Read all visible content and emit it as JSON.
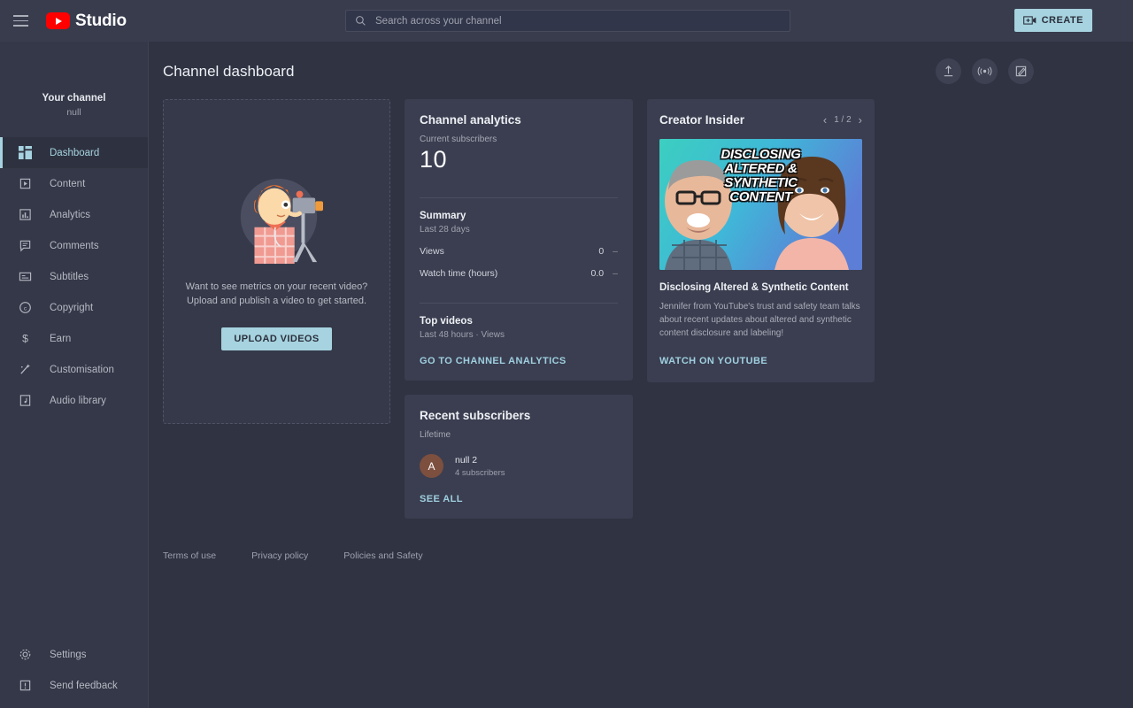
{
  "header": {
    "menu_icon": "hamburger-icon",
    "logo_text": "Studio",
    "search_placeholder": "Search across your channel",
    "search_value": "",
    "search_icon": "search-icon",
    "help_icon": "help-circle-icon",
    "create_label": "CREATE",
    "create_icon": "create-video-icon"
  },
  "sidebar": {
    "channel_label": "Your channel",
    "channel_name": "null",
    "items": [
      {
        "label": "Dashboard",
        "icon": "dashboard-grid-icon",
        "active": true
      },
      {
        "label": "Content",
        "icon": "content-video-icon",
        "active": false
      },
      {
        "label": "Analytics",
        "icon": "analytics-bar-icon",
        "active": false
      },
      {
        "label": "Comments",
        "icon": "comments-bubble-icon",
        "active": false
      },
      {
        "label": "Subtitles",
        "icon": "subtitles-icon",
        "active": false
      },
      {
        "label": "Copyright",
        "icon": "copyright-icon",
        "active": false
      },
      {
        "label": "Earn",
        "icon": "earn-dollar-icon",
        "active": false
      },
      {
        "label": "Customisation",
        "icon": "customisation-wand-icon",
        "active": false
      },
      {
        "label": "Audio library",
        "icon": "audio-library-icon",
        "active": false
      }
    ],
    "bottom_items": [
      {
        "label": "Settings",
        "icon": "gear-icon"
      },
      {
        "label": "Send feedback",
        "icon": "feedback-icon"
      }
    ]
  },
  "page": {
    "title": "Channel dashboard",
    "actions": [
      {
        "name": "upload-videos-button",
        "icon": "upload-arrow-icon"
      },
      {
        "name": "go-live-button",
        "icon": "broadcast-icon"
      },
      {
        "name": "create-post-button",
        "icon": "edit-pencil-icon"
      }
    ]
  },
  "empty_card": {
    "line1": "Want to see metrics on your recent video?",
    "line2": "Upload and publish a video to get started.",
    "button_label": "UPLOAD VIDEOS",
    "illustration": "videographer-illustration"
  },
  "analytics_card": {
    "title": "Channel analytics",
    "subs_label": "Current subscribers",
    "subs_value": "10",
    "summary_title": "Summary",
    "summary_period": "Last 28 days",
    "metrics": [
      {
        "label": "Views",
        "value": "0",
        "trend": "–"
      },
      {
        "label": "Watch time (hours)",
        "value": "0.0",
        "trend": "–"
      }
    ],
    "top_videos_title": "Top videos",
    "top_videos_sub": "Last 48 hours · Views",
    "link_label": "GO TO CHANNEL ANALYTICS"
  },
  "subscribers_card": {
    "title": "Recent subscribers",
    "period": "Lifetime",
    "rows": [
      {
        "initial": "A",
        "name": "null 2",
        "count": "4 subscribers",
        "avatar_color": "#7d4f3f"
      }
    ],
    "link_label": "SEE ALL"
  },
  "insider_card": {
    "title": "Creator Insider",
    "page_indicator": "1 / 2",
    "prev_icon": "chevron-left-icon",
    "next_icon": "chevron-right-icon",
    "thumbnail_text": "DISCLOSING ALTERED & SYNTHETIC CONTENT",
    "video_title": "Disclosing Altered & Synthetic Content",
    "description": "Jennifer from YouTube's trust and safety team talks about recent updates about altered and synthetic content disclosure and labeling!",
    "link_label": "WATCH ON YOUTUBE"
  },
  "footer": {
    "links": [
      {
        "label": "Terms of use"
      },
      {
        "label": "Privacy policy"
      },
      {
        "label": "Policies and Safety"
      }
    ]
  },
  "colors": {
    "page_bg": "#2f3342",
    "card_bg": "#3a3e50",
    "header_bg": "#383c4d",
    "sidebar_bg": "#343848",
    "accent": "#a6d3df",
    "link": "#9fcfe0",
    "brand_red": "#ff0000"
  }
}
